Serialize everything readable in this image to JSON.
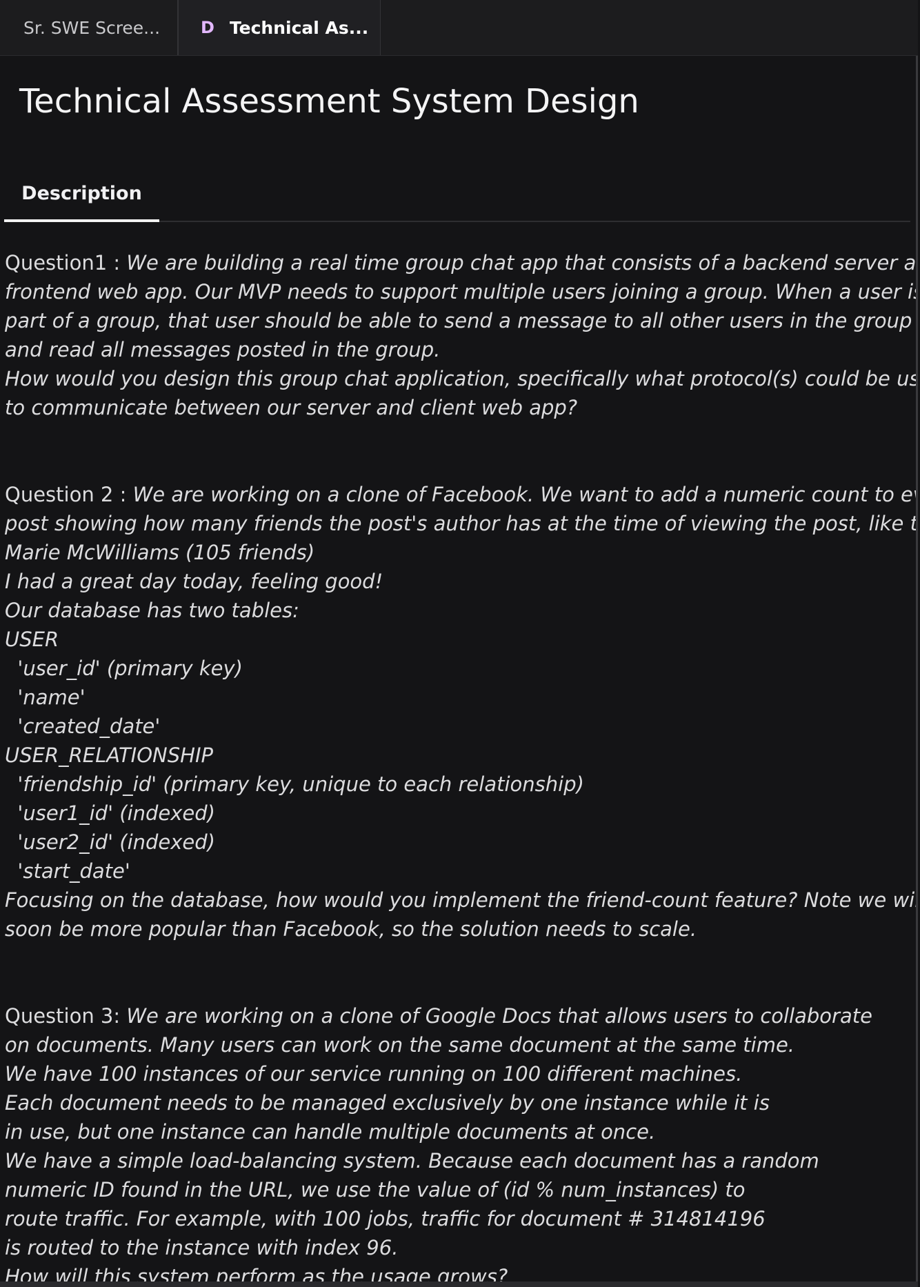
{
  "tabs": [
    {
      "label": "Sr. SWE Scree...",
      "active": false
    },
    {
      "badge": "D",
      "label": "Technical As...",
      "active": true
    }
  ],
  "page": {
    "title": "Technical Assessment System Design"
  },
  "subtabs": {
    "active_label": "Description"
  },
  "questions": {
    "q1": {
      "label": "Question1 : ",
      "lines": [
        "We are building a real time group chat app that consists of a backend server and a",
        "frontend web app. Our MVP needs to support multiple users joining a group. When a user is",
        "part of a group, that user should be able to send a message to all other users in the group",
        "and read all messages posted in the group.",
        "How would you design this group chat application, specifically what protocol(s) could be used",
        "to communicate between our server and client web app?"
      ]
    },
    "q2": {
      "label": "Question 2 : ",
      "lines": [
        "We are working on a clone of Facebook. We want to add a numeric count to every",
        "post showing how many friends the post's author has at the time of viewing the post, like this:",
        "Marie McWilliams (105 friends)",
        "I had a great day today, feeling good!",
        "Our database has two tables:",
        "USER",
        "  'user_id' (primary key)",
        "  'name'",
        "  'created_date'",
        "USER_RELATIONSHIP",
        "  'friendship_id' (primary key, unique to each relationship)",
        "  'user1_id' (indexed)",
        "  'user2_id' (indexed)",
        "  'start_date'",
        "Focusing on the database, how would you implement the friend-count feature? Note we will",
        "soon be more popular than Facebook, so the solution needs to scale."
      ]
    },
    "q3": {
      "label": "Question 3: ",
      "lines": [
        "We are working on a clone of Google Docs that allows users to collaborate",
        "on documents. Many users can work on the same document at the same time.",
        "We have 100 instances of our service running on 100 different machines.",
        "Each document needs to be managed exclusively by one instance while it is",
        "in use, but one instance can handle multiple documents at once.",
        "We have a simple load-balancing system. Because each document has a random",
        "numeric ID found in the URL, we use the value of (id % num_instances) to",
        "route traffic. For example, with 100 jobs, traffic for document # 314814196",
        "is routed to the instance with index 96.",
        "How will this system perform as the usage grows?"
      ]
    }
  }
}
